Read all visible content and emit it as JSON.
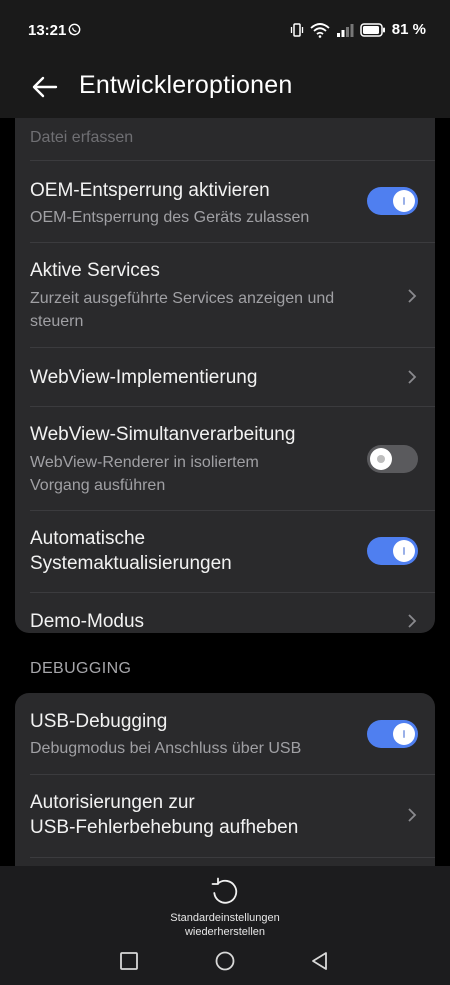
{
  "status_bar": {
    "time": "13:21",
    "battery": "81 %"
  },
  "app_bar": {
    "title": "Entwickleroptionen"
  },
  "settings": {
    "partial_top": "Datei erfassen",
    "oem": {
      "title": "OEM-Entsperrung aktivieren",
      "subtitle": "OEM-Entsperrung des Geräts zulassen",
      "enabled": true
    },
    "services": {
      "title": "Aktive Services",
      "subtitle_1": "Zurzeit ausgeführte Services anzeigen und",
      "subtitle_2": "steuern"
    },
    "webview_impl": {
      "title": "WebView-Implementierung"
    },
    "webview_multi": {
      "title": "WebView-Simultanverarbeitung",
      "subtitle_1": "WebView-Renderer in isoliertem",
      "subtitle_2": "Vorgang ausführen",
      "enabled": false
    },
    "auto_updates": {
      "title_1": "Automatische",
      "title_2": "Systemaktualisierungen",
      "enabled": true
    },
    "demo": {
      "title": "Demo-Modus"
    }
  },
  "debugging": {
    "section_title": "DEBUGGING",
    "usb": {
      "title": "USB-Debugging",
      "subtitle": "Debugmodus bei Anschluss über USB",
      "enabled": true
    },
    "revoke": {
      "title_1": "Autorisierungen zur",
      "title_2": "USB-Fehlerbehebung aufheben"
    }
  },
  "bottom": {
    "reset_line_1": "Standardeinstellungen",
    "reset_line_2": "wiederherstellen"
  },
  "colors": {
    "accent": "#4f7ff0",
    "card": "#2a2a2c",
    "background": "#000000"
  },
  "icons": [
    "whatsapp-icon",
    "vibrate-icon",
    "wifi-icon",
    "signal-icon",
    "battery-icon",
    "back-arrow-icon",
    "chevron-right-icon",
    "reset-icon",
    "recent-apps-icon",
    "home-icon",
    "back-icon"
  ]
}
